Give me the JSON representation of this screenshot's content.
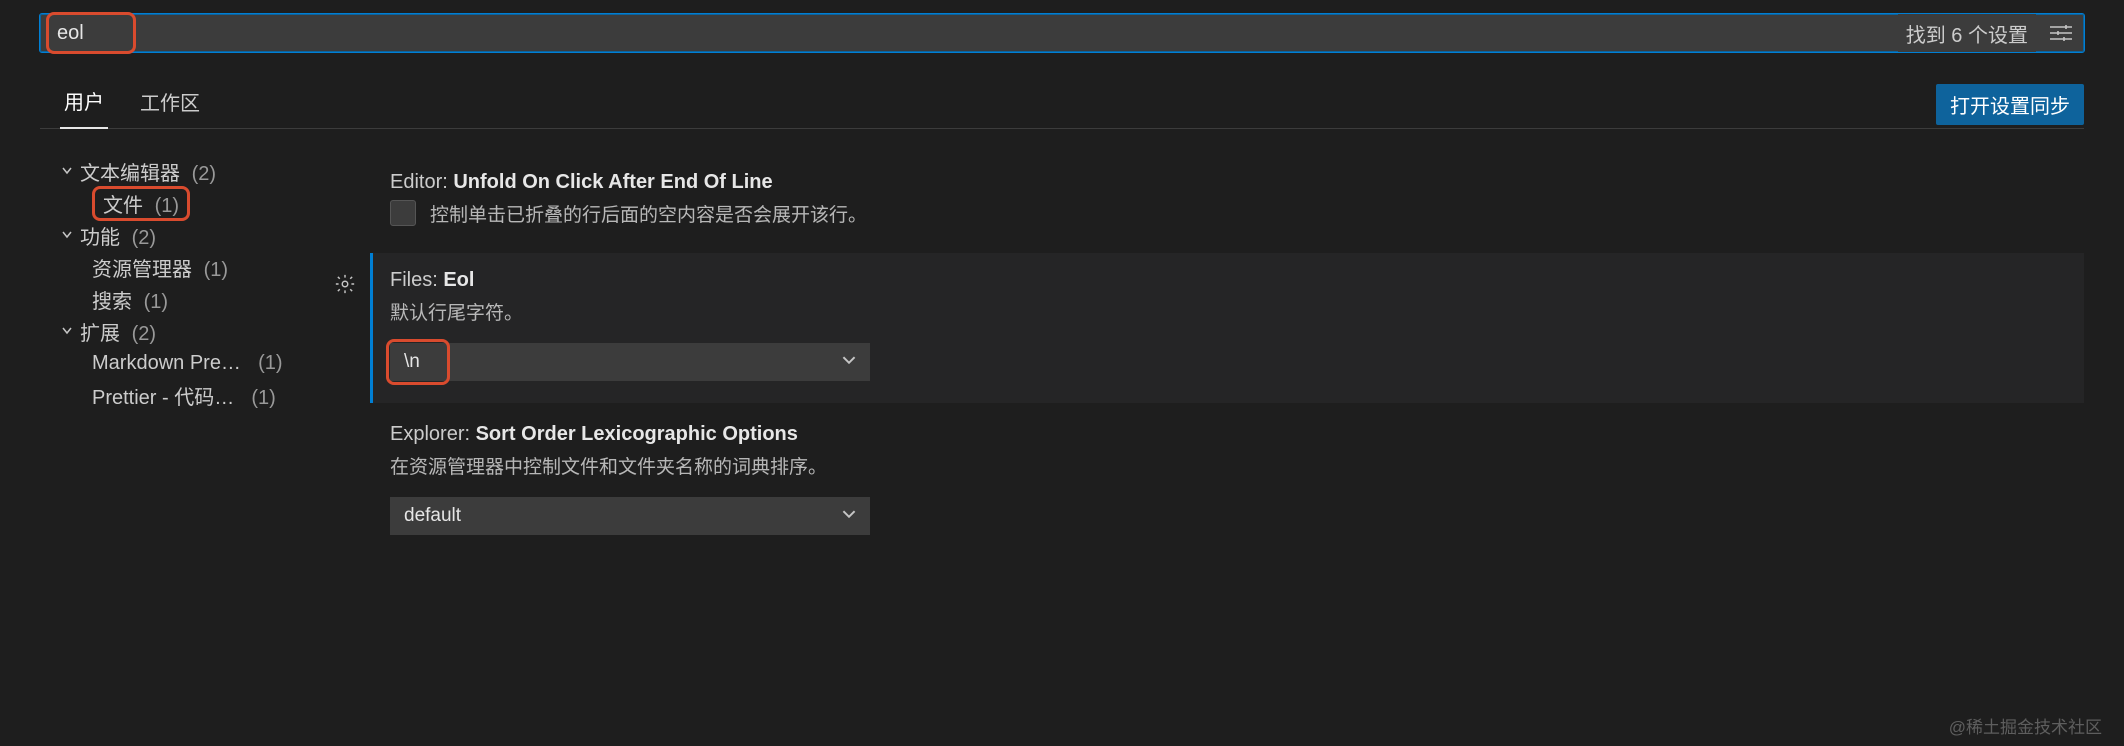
{
  "search": {
    "value": "eol",
    "result_text": "找到 6 个设置"
  },
  "tabs": {
    "user": "用户",
    "workspace": "工作区"
  },
  "sync_button": "打开设置同步",
  "tree": {
    "text_editor": {
      "label": "文本编辑器",
      "count": "(2)"
    },
    "file": {
      "label": "文件",
      "count": "(1)"
    },
    "features": {
      "label": "功能",
      "count": "(2)"
    },
    "explorer": {
      "label": "资源管理器",
      "count": "(1)"
    },
    "search": {
      "label": "搜索",
      "count": "(1)"
    },
    "extensions": {
      "label": "扩展",
      "count": "(2)"
    },
    "markdown": {
      "label": "Markdown Pre…",
      "count": "(1)"
    },
    "prettier": {
      "label": "Prettier - 代码…",
      "count": "(1)"
    }
  },
  "settings": {
    "unfold": {
      "prefix": "Editor: ",
      "name": "Unfold On Click After End Of Line",
      "desc": "控制单击已折叠的行后面的空内容是否会展开该行。"
    },
    "eol": {
      "prefix": "Files: ",
      "name": "Eol",
      "desc": "默认行尾字符。",
      "value": "\\n"
    },
    "sortorder": {
      "prefix": "Explorer: ",
      "name": "Sort Order Lexicographic Options",
      "desc": "在资源管理器中控制文件和文件夹名称的词典排序。",
      "value": "default"
    }
  },
  "watermark": "@稀土掘金技术社区"
}
